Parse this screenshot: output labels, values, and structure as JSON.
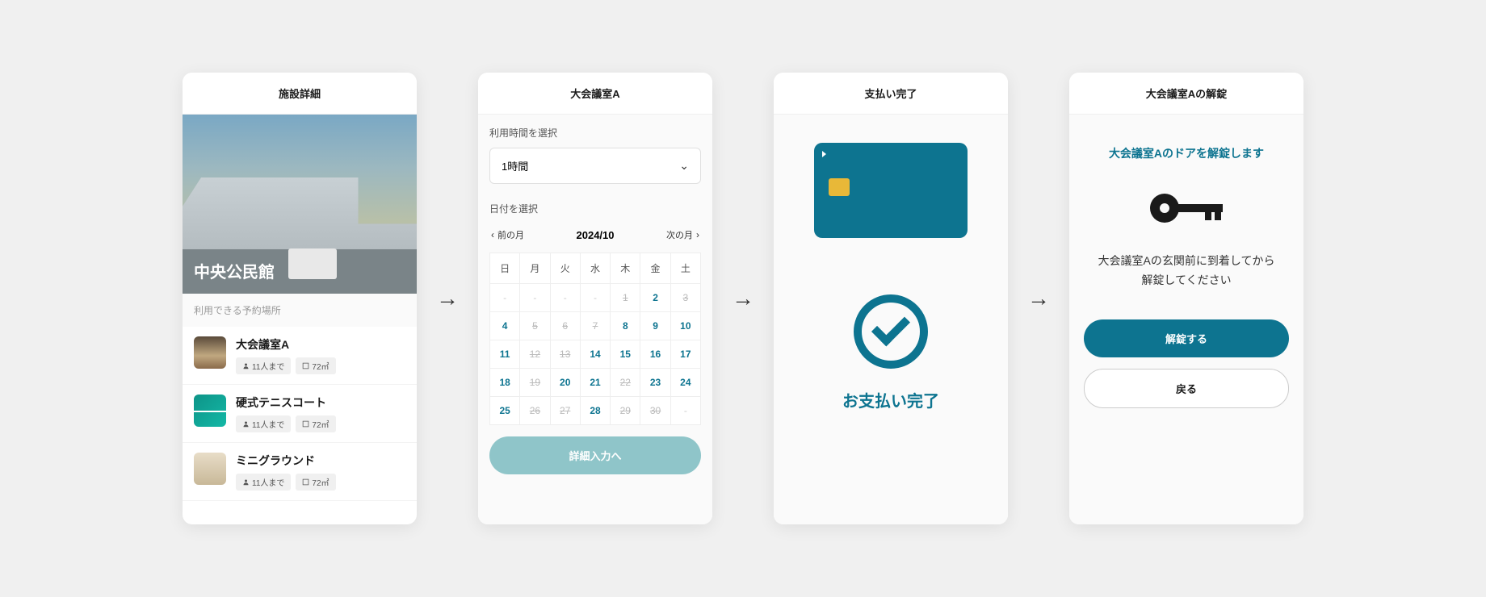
{
  "screen1": {
    "header": "施設詳細",
    "heroTitle": "中央公民館",
    "sectionLabel": "利用できる予約場所",
    "rooms": [
      {
        "name": "大会議室A",
        "capacity": "11人まで",
        "area": "72㎡"
      },
      {
        "name": "硬式テニスコート",
        "capacity": "11人まで",
        "area": "72㎡"
      },
      {
        "name": "ミニグラウンド",
        "capacity": "11人まで",
        "area": "72㎡"
      }
    ]
  },
  "screen2": {
    "header": "大会議室A",
    "durationLabel": "利用時間を選択",
    "durationValue": "1時間",
    "dateLabel": "日付を選択",
    "prevMonth": "前の月",
    "monthTitle": "2024/10",
    "nextMonth": "次の月",
    "dow": [
      "日",
      "月",
      "火",
      "水",
      "木",
      "金",
      "土"
    ],
    "weeks": [
      [
        {
          "t": "-",
          "s": "blank"
        },
        {
          "t": "-",
          "s": "blank"
        },
        {
          "t": "-",
          "s": "blank"
        },
        {
          "t": "-",
          "s": "blank"
        },
        {
          "t": "1",
          "s": "disabled"
        },
        {
          "t": "2",
          "s": "avail"
        },
        {
          "t": "3",
          "s": "disabled"
        }
      ],
      [
        {
          "t": "4",
          "s": "avail"
        },
        {
          "t": "5",
          "s": "disabled"
        },
        {
          "t": "6",
          "s": "disabled"
        },
        {
          "t": "7",
          "s": "disabled"
        },
        {
          "t": "8",
          "s": "avail"
        },
        {
          "t": "9",
          "s": "avail"
        },
        {
          "t": "10",
          "s": "avail"
        }
      ],
      [
        {
          "t": "11",
          "s": "avail"
        },
        {
          "t": "12",
          "s": "disabled"
        },
        {
          "t": "13",
          "s": "disabled"
        },
        {
          "t": "14",
          "s": "avail"
        },
        {
          "t": "15",
          "s": "avail"
        },
        {
          "t": "16",
          "s": "avail"
        },
        {
          "t": "17",
          "s": "avail"
        }
      ],
      [
        {
          "t": "18",
          "s": "avail"
        },
        {
          "t": "19",
          "s": "disabled"
        },
        {
          "t": "20",
          "s": "avail"
        },
        {
          "t": "21",
          "s": "avail"
        },
        {
          "t": "22",
          "s": "disabled"
        },
        {
          "t": "23",
          "s": "avail"
        },
        {
          "t": "24",
          "s": "avail"
        }
      ],
      [
        {
          "t": "25",
          "s": "avail"
        },
        {
          "t": "26",
          "s": "disabled"
        },
        {
          "t": "27",
          "s": "disabled"
        },
        {
          "t": "28",
          "s": "avail"
        },
        {
          "t": "29",
          "s": "disabled"
        },
        {
          "t": "30",
          "s": "disabled"
        },
        {
          "t": "-",
          "s": "blank"
        }
      ]
    ],
    "submit": "詳細入力へ"
  },
  "screen3": {
    "header": "支払い完了",
    "message": "お支払い完了"
  },
  "screen4": {
    "header": "大会議室Aの解錠",
    "heading": "大会議室Aのドアを解錠します",
    "body1": "大会議室Aの玄関前に到着してから",
    "body2": "解錠してください",
    "unlockBtn": "解錠する",
    "backBtn": "戻る"
  }
}
